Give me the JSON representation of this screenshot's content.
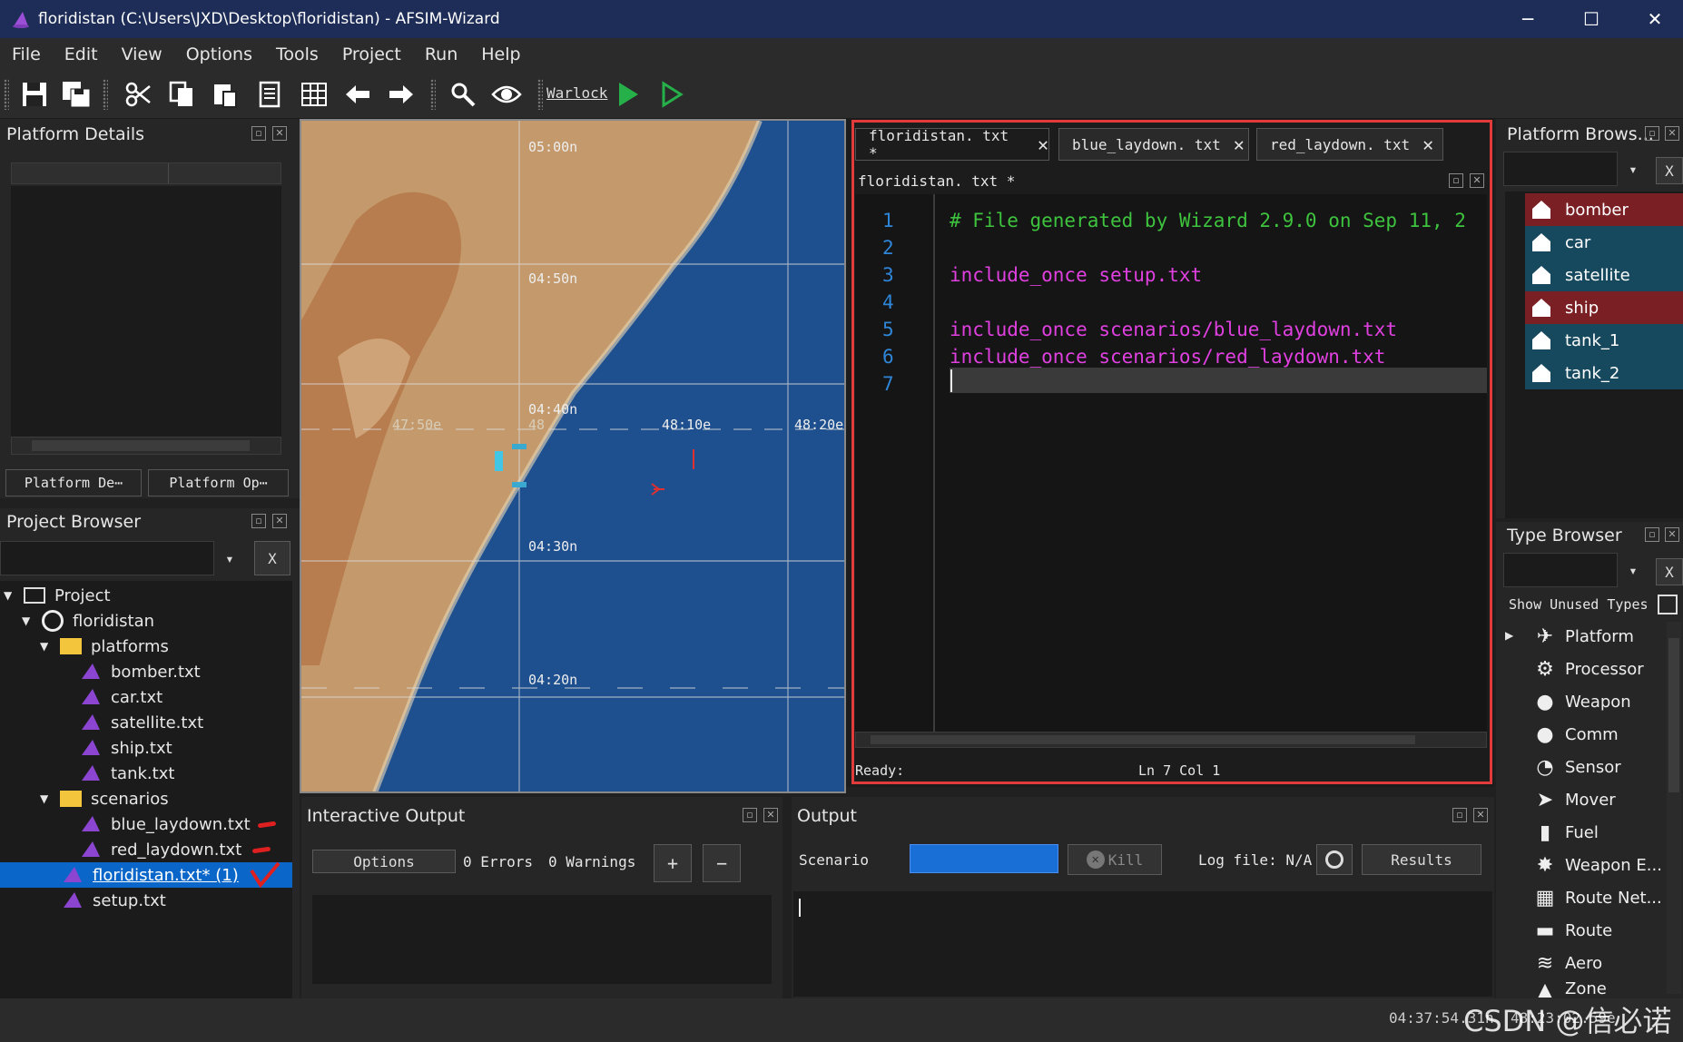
{
  "window": {
    "title": "floridistan (C:\\Users\\JXD\\Desktop\\floridistan) - AFSIM-Wizard",
    "minimize": "─",
    "maximize": "☐",
    "close": "✕"
  },
  "menu": [
    "File",
    "Edit",
    "View",
    "Options",
    "Tools",
    "Project",
    "Run",
    "Help"
  ],
  "toolbar": {
    "warlock_label": "Warlock"
  },
  "platform_details": {
    "title": "Platform Details",
    "tab1": "Platform De⋯",
    "tab2": "Platform Op⋯"
  },
  "project_browser": {
    "title": "Project Browser",
    "clear": "X",
    "items": [
      {
        "label": "Project"
      },
      {
        "label": "floridistan"
      },
      {
        "label": "platforms"
      },
      {
        "label": "bomber.txt"
      },
      {
        "label": "car.txt"
      },
      {
        "label": "satellite.txt"
      },
      {
        "label": "ship.txt"
      },
      {
        "label": "tank.txt"
      },
      {
        "label": "scenarios"
      },
      {
        "label": "blue_laydown.txt"
      },
      {
        "label": "red_laydown.txt"
      },
      {
        "label": "floridistan.txt* (1)"
      },
      {
        "label": "setup.txt"
      }
    ]
  },
  "map": {
    "labels": [
      "05:00n",
      "04:50n",
      "04:40n",
      "48:10e",
      "48:20e",
      "04:30n",
      "04:20n",
      "47:50e",
      "48"
    ]
  },
  "editor": {
    "tabs": [
      {
        "label": "floridistan. txt *"
      },
      {
        "label": "blue_laydown. txt"
      },
      {
        "label": "red_laydown. txt"
      }
    ],
    "filename": "floridistan. txt *",
    "line_numbers": [
      "1",
      "2",
      "3",
      "4",
      "5",
      "6",
      "7"
    ],
    "lines": [
      "# File generated by Wizard 2.9.0 on Sep 11, 2",
      "",
      "include_once setup.txt",
      "",
      "include_once scenarios/blue_laydown.txt",
      "include_once scenarios/red_laydown.txt",
      ""
    ],
    "status": "Ready:",
    "position": "Ln 7  Col 1",
    "colors": {
      "comment": "#3ec33e",
      "keyword": "#e040e0",
      "highlight": "#e23b3b"
    }
  },
  "platform_browser": {
    "title": "Platform Brows...",
    "clear": "X",
    "items": [
      {
        "label": "bomber",
        "team": "red"
      },
      {
        "label": "car",
        "team": "blue"
      },
      {
        "label": "satellite",
        "team": "blue"
      },
      {
        "label": "ship",
        "team": "red"
      },
      {
        "label": "tank_1",
        "team": "blue"
      },
      {
        "label": "tank_2",
        "team": "blue"
      }
    ],
    "colors": {
      "red": "#7a1f24",
      "blue": "#17495e"
    }
  },
  "type_browser": {
    "title": "Type Browser",
    "clear": "X",
    "show_unused": "Show Unused Types",
    "items": [
      "Platform",
      "Processor",
      "Weapon",
      "Comm",
      "Sensor",
      "Mover",
      "Fuel",
      "Weapon E...",
      "Route Net...",
      "Route",
      "Aero",
      "Zone"
    ]
  },
  "interactive_output": {
    "title": "Interactive Output",
    "options": "Options",
    "errors": "0 Errors",
    "warnings": "0 Warnings",
    "plus": "+",
    "minus": "−"
  },
  "output": {
    "title": "Output",
    "scenario": "Scenario",
    "kill": "Kill",
    "logfile": "Log file: N/A",
    "results": "Results"
  },
  "statusbar": {
    "time": "04:37:54.31n",
    "coord": "48:23:02.59e",
    "watermark": "CSDN @信必诺"
  }
}
